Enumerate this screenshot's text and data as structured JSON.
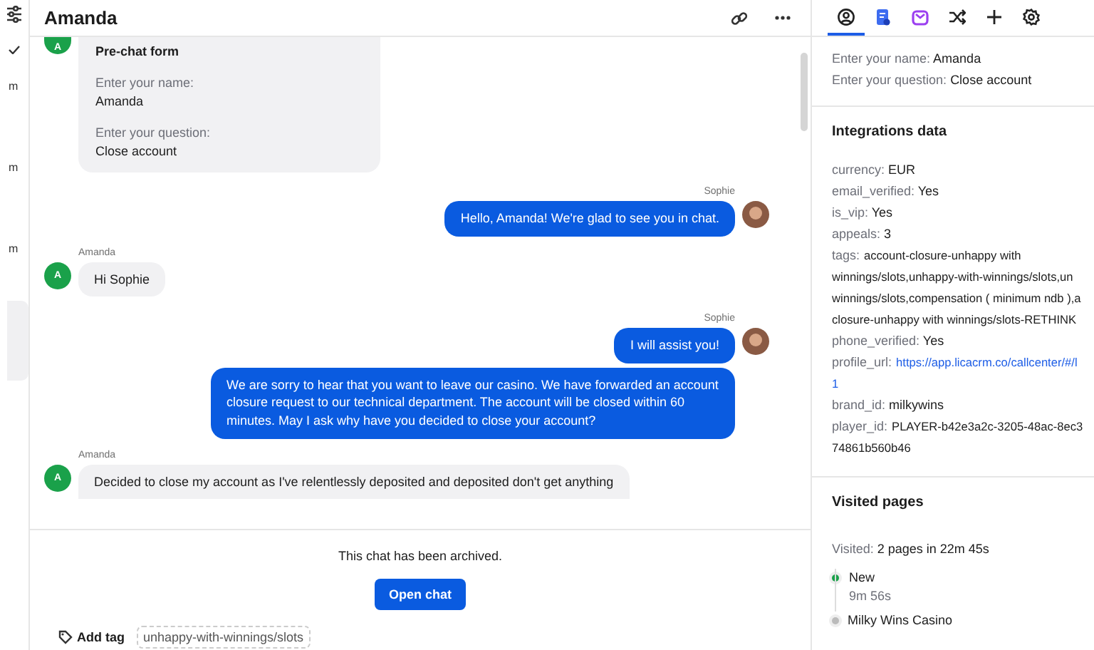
{
  "left_strip": {
    "times": [
      "m",
      "m",
      "m"
    ]
  },
  "chat": {
    "title": "Amanda",
    "prechat_form": {
      "avatar": "A",
      "title": "Pre-chat form",
      "fields": [
        {
          "label": "Enter your name:",
          "value": "Amanda"
        },
        {
          "label": "Enter your question:",
          "value": "Close account"
        }
      ]
    },
    "messages": [
      {
        "kind": "agent",
        "author": "Sophie",
        "texts": [
          "Hello, Amanda! We're glad to see you in chat."
        ]
      },
      {
        "kind": "visitor",
        "author": "Amanda",
        "avatar": "A",
        "texts": [
          "Hi Sophie"
        ]
      },
      {
        "kind": "agent",
        "author": "Sophie",
        "texts": [
          "I will assist you!",
          "We are sorry to hear that you want to leave our casino. We have forwarded an account closure request to our technical department. The account will be closed within 60 minutes. May I ask why have you decided to close your account?"
        ]
      },
      {
        "kind": "visitor",
        "author": "Amanda",
        "avatar": "A",
        "texts": [
          "Decided to close my account as I've relentlessly deposited and deposited don't get anything"
        ]
      }
    ],
    "archived_note": "This chat has been archived.",
    "open_button": "Open chat",
    "add_tag": "Add tag",
    "tags": [
      "unhappy-with-winnings/slots"
    ]
  },
  "details": {
    "tabs": [
      {
        "kind": "person",
        "selected": true
      },
      {
        "kind": "doc",
        "selected": false
      },
      {
        "kind": "box",
        "selected": false
      },
      {
        "kind": "shuffle",
        "selected": false
      },
      {
        "kind": "plus",
        "selected": false
      },
      {
        "kind": "gear",
        "selected": false
      }
    ],
    "form_fields": [
      {
        "label": "Enter your name:",
        "value": "Amanda"
      },
      {
        "label": "Enter your question:",
        "value": "Close account"
      }
    ],
    "integrations": {
      "title": "Integrations data",
      "fields": [
        {
          "label": "currency:",
          "lines": [
            "EUR"
          ]
        },
        {
          "label": "email_verified:",
          "lines": [
            "Yes"
          ]
        },
        {
          "label": "is_vip:",
          "lines": [
            "Yes"
          ]
        },
        {
          "label": "appeals:",
          "lines": [
            "3"
          ]
        },
        {
          "label": "tags:",
          "lines": [
            "account-closure-unhappy with",
            "winnings/slots,unhappy-with-winnings/slots,un",
            "winnings/slots,compensation ( minimum ndb ),a",
            "closure-unhappy with winnings/slots-RETHINK"
          ]
        },
        {
          "label": "phone_verified:",
          "lines": [
            "Yes"
          ]
        },
        {
          "label": "profile_url:",
          "link": true,
          "lines": [
            "https://app.licacrm.co/callcenter/#/l",
            "1"
          ]
        },
        {
          "label": "brand_id:",
          "lines": [
            "milkywins"
          ]
        },
        {
          "label": "player_id:",
          "lines": [
            "PLAYER-b42e3a2c-3205-48ac-8ec3",
            "74861b560b46"
          ]
        }
      ]
    },
    "visited": {
      "title": "Visited pages",
      "label": "Visited:",
      "summary": "2 pages in 22m 45s",
      "pages": [
        {
          "title": "New",
          "time": "9m 56s",
          "current": true
        },
        {
          "title": "Milky Wins Casino",
          "current": false
        }
      ]
    }
  }
}
